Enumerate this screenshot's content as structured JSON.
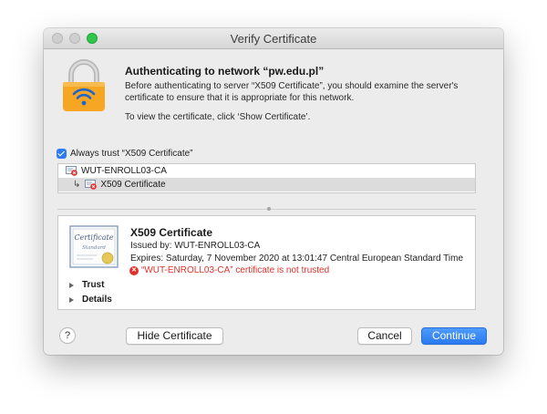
{
  "window": {
    "title": "Verify Certificate"
  },
  "header": {
    "heading": "Authenticating to network “pw.edu.pl”",
    "body1": "Before authenticating to server “X509 Certificate”, you should examine the server's certificate to ensure that it is appropriate for this network.",
    "body2": "To view the certificate, click ‘Show Certificate’."
  },
  "always_trust": {
    "label": "Always trust “X509 Certificate”",
    "checked": true
  },
  "tree": {
    "items": [
      {
        "label": "WUT-ENROLL03-CA"
      },
      {
        "label": "X509 Certificate",
        "selected": true
      }
    ]
  },
  "detail": {
    "name": "X509 Certificate",
    "issued_by": "Issued by: WUT-ENROLL03-CA",
    "expires": "Expires: Saturday, 7 November 2020 at 13:01:47 Central European Standard Time",
    "warning": "“WUT-ENROLL03-CA” certificate is not trusted",
    "thumb_text_1": "Certificate",
    "thumb_text_2": "Standard",
    "sections": [
      "Trust",
      "Details"
    ]
  },
  "buttons": {
    "help": "?",
    "hide": "Hide Certificate",
    "cancel": "Cancel",
    "continue": "Continue"
  },
  "colors": {
    "accent": "#2f7bf4",
    "warning": "#e0322c",
    "lock": "#f6a623"
  }
}
